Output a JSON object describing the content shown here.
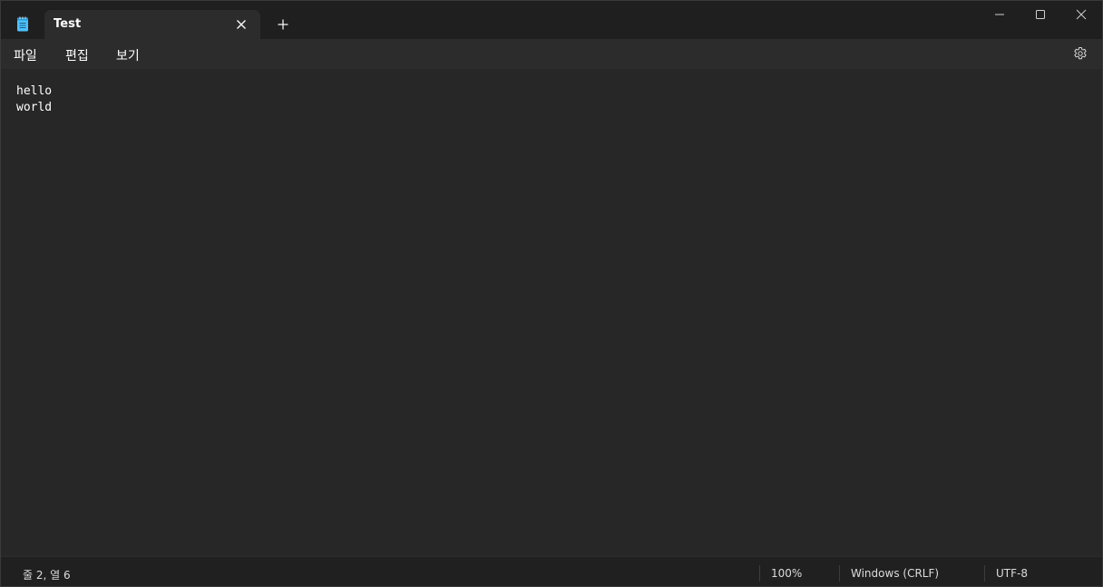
{
  "window": {
    "tab_title": "Test"
  },
  "menu": {
    "file": "파일",
    "edit": "편집",
    "view": "보기"
  },
  "editor": {
    "lines": [
      "hello",
      "world"
    ]
  },
  "status": {
    "position": "줄 2, 열 6",
    "zoom": "100%",
    "line_ending": "Windows (CRLF)",
    "encoding": "UTF-8"
  },
  "icons": {
    "app": "notepad-icon",
    "tab_close": "close-icon",
    "new_tab": "plus-icon",
    "minimize": "minimize-icon",
    "maximize": "maximize-icon",
    "close": "close-icon",
    "settings": "gear-icon"
  },
  "colors": {
    "background": "#272727",
    "titlebar": "#1f1f1f",
    "tab_active": "#2c2c2c",
    "accent_icon": "#4cc2ff"
  }
}
